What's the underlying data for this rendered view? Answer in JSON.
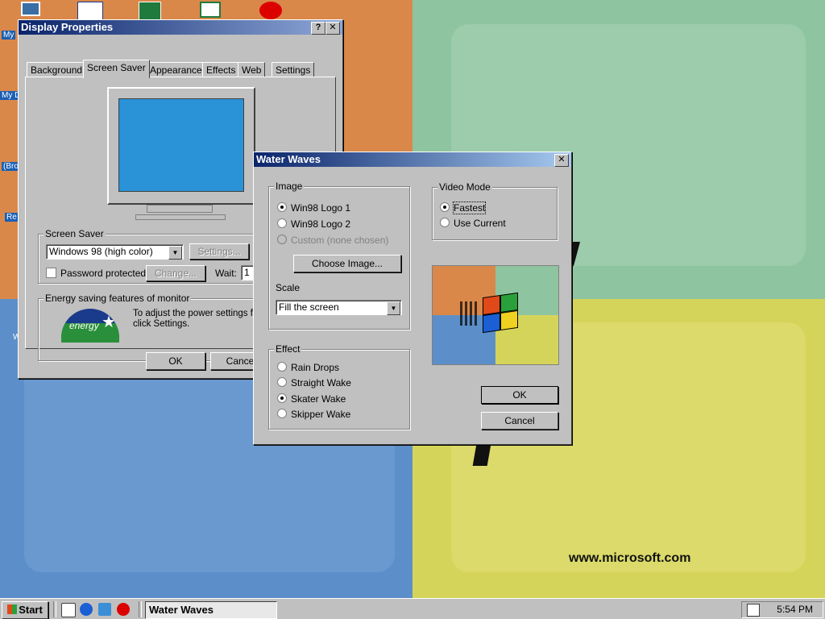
{
  "desktop": {
    "url_text": "www.microsoft.com",
    "left_icon_labels": [
      "My",
      "My D",
      "(Bro",
      "Re",
      "W"
    ]
  },
  "display_properties": {
    "title": "Display Properties",
    "tabs": [
      "Background",
      "Screen Saver",
      "Appearance",
      "Effects",
      "Web",
      "Settings"
    ],
    "active_tab": "Screen Saver",
    "screen_saver_label": "Screen Saver",
    "screen_saver_value": "Windows 98 (high color)",
    "settings_label": "Settings...",
    "password_label": "Password protected",
    "change_label": "Change...",
    "wait_label": "Wait:",
    "wait_value": "1",
    "energy_label": "Energy saving features of monitor",
    "energy_text": "To adjust the power settings for\nclick Settings.",
    "energy_logo_text": "energy",
    "ok_label": "OK",
    "cancel_label": "Cance"
  },
  "water_waves": {
    "title": "Water Waves",
    "image_group": "Image",
    "image_options": [
      {
        "label": "Win98 Logo 1",
        "selected": true,
        "disabled": false
      },
      {
        "label": "Win98 Logo 2",
        "selected": false,
        "disabled": false
      },
      {
        "label": "Custom (none chosen)",
        "selected": false,
        "disabled": true
      }
    ],
    "choose_image_label": "Choose Image...",
    "scale_label": "Scale",
    "scale_value": "Fill the screen",
    "effect_group": "Effect",
    "effect_options": [
      {
        "label": "Rain Drops",
        "selected": false
      },
      {
        "label": "Straight Wake",
        "selected": false
      },
      {
        "label": "Skater Wake",
        "selected": true
      },
      {
        "label": "Skipper Wake",
        "selected": false
      }
    ],
    "video_mode_group": "Video Mode",
    "video_options": [
      {
        "label": "Fastest",
        "selected": true
      },
      {
        "label": "Use Current",
        "selected": false
      }
    ],
    "ok_label": "OK",
    "cancel_label": "Cancel"
  },
  "taskbar": {
    "start_label": "Start",
    "task_label": "Water Waves",
    "clock": "5:54 PM"
  },
  "colors": {
    "title_active": "#0a246a",
    "face": "#c0c0c0",
    "monitor_screen": "#2a92d6"
  }
}
